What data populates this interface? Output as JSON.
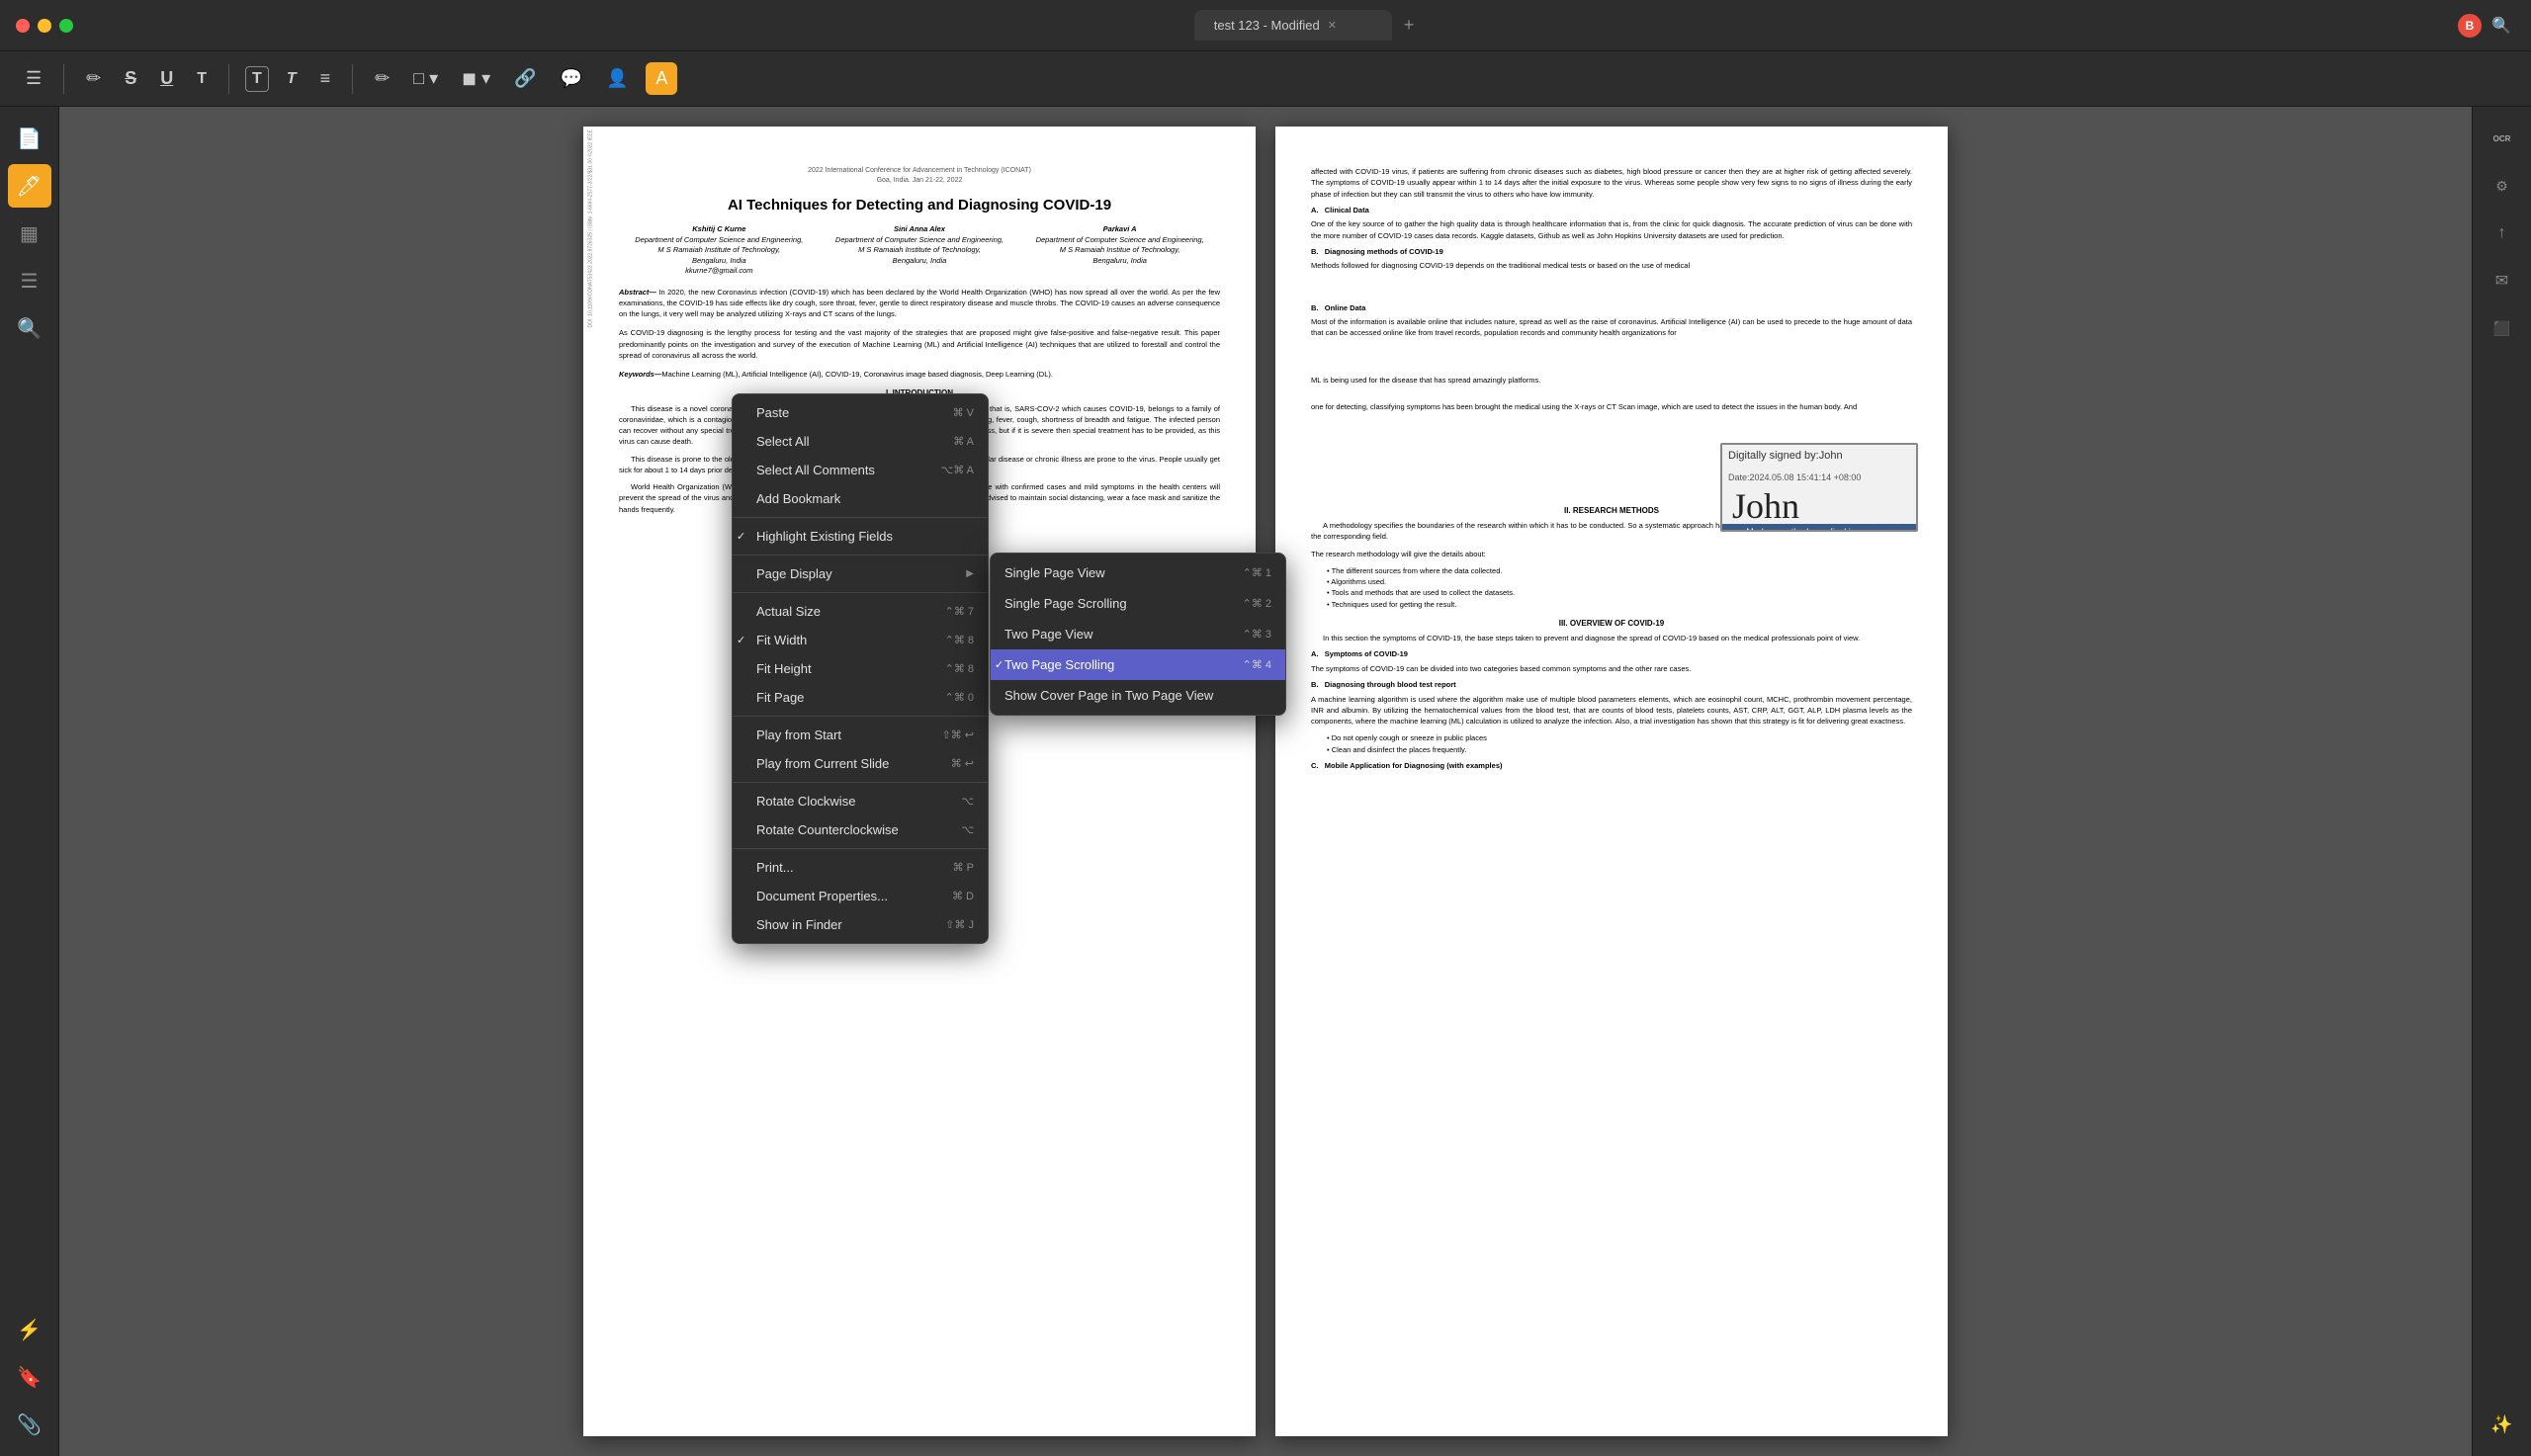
{
  "titlebar": {
    "tab_label": "test 123 - Modified",
    "add_tab_label": "+",
    "search_icon": "🔍"
  },
  "toolbar": {
    "icons": [
      {
        "name": "sidebar-toggle",
        "symbol": "☰"
      },
      {
        "name": "annotation-highlight",
        "symbol": "✏️"
      },
      {
        "name": "strikethrough",
        "symbol": "S"
      },
      {
        "name": "underline",
        "symbol": "U"
      },
      {
        "name": "text-tool",
        "symbol": "T"
      },
      {
        "name": "text-box",
        "symbol": "T"
      },
      {
        "name": "text-callout",
        "symbol": "T"
      },
      {
        "name": "list-tool",
        "symbol": "≡"
      },
      {
        "name": "pencil-tool",
        "symbol": "✏"
      },
      {
        "name": "shape-tool",
        "symbol": "□"
      },
      {
        "name": "stamp-tool",
        "symbol": "◼"
      },
      {
        "name": "link-tool",
        "symbol": "🔗"
      },
      {
        "name": "comment-tool",
        "symbol": "💬"
      },
      {
        "name": "person-tool",
        "symbol": "👤"
      },
      {
        "name": "color-tool",
        "symbol": "A"
      }
    ]
  },
  "left_sidebar": {
    "icons": [
      {
        "name": "document-icon",
        "symbol": "📄"
      },
      {
        "name": "bookmark-icon",
        "symbol": "🔖"
      },
      {
        "name": "annotation-icon",
        "symbol": "✏️"
      },
      {
        "name": "page-thumbnail",
        "symbol": "▦"
      },
      {
        "name": "search-icon",
        "symbol": "🔍"
      },
      {
        "name": "signature-icon",
        "symbol": "✒"
      },
      {
        "name": "layers-icon",
        "symbol": "⚡"
      },
      {
        "name": "star-icon",
        "symbol": "★"
      },
      {
        "name": "paperclip-icon",
        "symbol": "📎"
      }
    ]
  },
  "right_sidebar": {
    "icons": [
      {
        "name": "ocr-icon",
        "symbol": "OCR"
      },
      {
        "name": "compress-icon",
        "symbol": "⚙"
      },
      {
        "name": "share-icon",
        "symbol": "↑"
      },
      {
        "name": "mail-icon",
        "symbol": "✉"
      },
      {
        "name": "redact-icon",
        "symbol": "⬛"
      },
      {
        "name": "magic-icon",
        "symbol": "✨"
      }
    ]
  },
  "document": {
    "conference": "2022 International Conference for Advancement in Technology (ICONAT)",
    "location": "Goa, India. Jan 21-22, 2022",
    "title": "AI Techniques for Detecting and Diagnosing COVID-19",
    "authors": [
      {
        "name": "Kshitij C Kurne",
        "dept": "Department of Computer Science and Engineering,",
        "institute": "M S Ramaiah Institute of Technology,",
        "city": "Bengaluru, India",
        "email": "kkurne7@gmail.com"
      },
      {
        "name": "Sini Anna Alex",
        "dept": "Department of Computer Science and Engineering,",
        "institute": "M S Ramaiah Institute of Technology,",
        "city": "Bengaluru, India"
      },
      {
        "name": "Parkavi A",
        "dept": "Department of Computer Science and Engineering,",
        "institute": "M S Ramaiah Institue of Technology,",
        "city": "Bengaluru, India"
      }
    ],
    "abstract_label": "Abstract—",
    "abstract_text": "In 2020, the new Coronavirus infection (COVID-19) which has been declared by the World Health Organization (WHO) has now spread all over the world. As per the few examinations, the COVID-19 has side effects like dry cough, sore throat, fever, gentle to direct respiratory disease and muscle throbs. The COVID-19 causes an adverse consequence on the lungs, it very well may be analyzed utilizing X-rays and CT scans of the lungs.",
    "keywords_label": "Keywords—",
    "keywords_text": "Machine Learning (ML), Artificial Intelligence (AI), COVID-19, Coronavirus image based diagnosis, Deep Learning (DL)."
  },
  "context_menu": {
    "items": [
      {
        "label": "Paste",
        "shortcut": "⌘ V",
        "checked": false,
        "has_submenu": false
      },
      {
        "label": "Select All",
        "shortcut": "⌘ A",
        "checked": false,
        "has_submenu": false
      },
      {
        "label": "Select All Comments",
        "shortcut": "⌥⌘ A",
        "checked": false,
        "has_submenu": false
      },
      {
        "label": "Add Bookmark",
        "shortcut": "",
        "checked": false,
        "has_submenu": false
      },
      {
        "label": "Highlight Existing Fields",
        "shortcut": "",
        "checked": true,
        "has_submenu": false
      },
      {
        "label": "Page Display",
        "shortcut": "",
        "checked": false,
        "has_submenu": true
      },
      {
        "label": "Actual Size",
        "shortcut": "⌃⌘ 7",
        "checked": false,
        "has_submenu": false
      },
      {
        "label": "Fit Width",
        "shortcut": "⌃⌘ 8",
        "checked": true,
        "has_submenu": false
      },
      {
        "label": "Fit Height",
        "shortcut": "⌃⌘ 8",
        "checked": false,
        "has_submenu": false
      },
      {
        "label": "Fit Page",
        "shortcut": "⌃⌘ 0",
        "checked": false,
        "has_submenu": false
      },
      {
        "label": "Play from Start",
        "shortcut": "⇧⌘ ↩",
        "checked": false,
        "has_submenu": false
      },
      {
        "label": "Play from Current Slide",
        "shortcut": "⌘ ↩",
        "checked": false,
        "has_submenu": false
      },
      {
        "label": "Rotate Clockwise",
        "shortcut": "⌥",
        "checked": false,
        "has_submenu": false
      },
      {
        "label": "Rotate Counterclockwise",
        "shortcut": "⌥",
        "checked": false,
        "has_submenu": false
      },
      {
        "label": "Print...",
        "shortcut": "⌘ P",
        "checked": false,
        "has_submenu": false
      },
      {
        "label": "Document Properties...",
        "shortcut": "⌘ D",
        "checked": false,
        "has_submenu": false
      },
      {
        "label": "Show in Finder",
        "shortcut": "⇧⌘ J",
        "checked": false,
        "has_submenu": false
      }
    ]
  },
  "submenu": {
    "items": [
      {
        "label": "Single Page View",
        "shortcut": "⌃⌘ 1",
        "checked": false,
        "highlighted": false
      },
      {
        "label": "Single Page Scrolling",
        "shortcut": "⌃⌘ 2",
        "checked": false,
        "highlighted": false
      },
      {
        "label": "Two Page View",
        "shortcut": "⌃⌘ 3",
        "checked": false,
        "highlighted": false
      },
      {
        "label": "Two Page Scrolling",
        "shortcut": "⌃⌘ 4",
        "checked": true,
        "highlighted": true
      },
      {
        "label": "Show Cover Page in Two Page View",
        "shortcut": "",
        "checked": false,
        "highlighted": false
      }
    ]
  },
  "signature": {
    "label": "Digitally signed by:John",
    "date": "Date:2024.05.08 15:41:14 +08:00",
    "name": "John",
    "bar_label": "Modern methods medical image so..."
  },
  "colors": {
    "accent": "#5b5fc7",
    "toolbar_bg": "#2d2d2d",
    "page_bg": "#525252",
    "menu_bg": "#2d2d2d",
    "menu_highlight": "#5b5fc7",
    "checked_color": "#5b5fc7"
  }
}
